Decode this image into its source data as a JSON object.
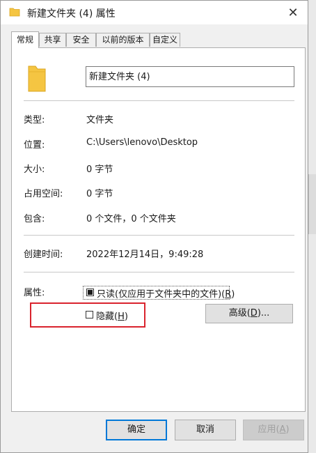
{
  "window": {
    "title": "新建文件夹 (4) 属性",
    "close_glyph": "✕"
  },
  "tabs": [
    {
      "label": "常规",
      "active": true
    },
    {
      "label": "共享",
      "active": false
    },
    {
      "label": "安全",
      "active": false
    },
    {
      "label": "以前的版本",
      "active": false
    },
    {
      "label": "自定义",
      "active": false
    }
  ],
  "general": {
    "folder_name": "新建文件夹 (4)",
    "fields": {
      "type_label": "类型:",
      "type_value": "文件夹",
      "location_label": "位置:",
      "location_value": "C:\\Users\\lenovo\\Desktop",
      "size_label": "大小:",
      "size_value": "0 字节",
      "disk_label": "占用空间:",
      "disk_value": "0 字节",
      "contains_label": "包含:",
      "contains_value": "0 个文件，0 个文件夹",
      "created_label": "创建时间:",
      "created_value": "2022年12月14日，9:49:28"
    },
    "attributes": {
      "label": "属性:",
      "readonly_text": "只读(仅应用于文件夹中的文件)(",
      "readonly_key": "R",
      "readonly_close": ")",
      "readonly_state": "indeterminate",
      "hidden_text": "隐藏(",
      "hidden_key": "H",
      "hidden_close": ")",
      "hidden_checked": false,
      "advanced_text": "高级(",
      "advanced_key": "D",
      "advanced_close": ")..."
    }
  },
  "footer": {
    "ok": "确定",
    "cancel": "取消",
    "apply": "应用(",
    "apply_key": "A",
    "apply_close": ")"
  },
  "colors": {
    "highlight_box": "#d9232d",
    "folder_yellow": "#f5c542",
    "default_button_border": "#0078d7"
  }
}
